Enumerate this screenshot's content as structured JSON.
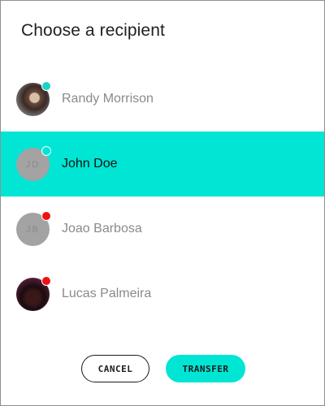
{
  "dialog": {
    "title": "Choose a recipient"
  },
  "recipients": [
    {
      "name": "Randy Morrison",
      "initials": "",
      "status_color": "#19d3c5",
      "selected": false
    },
    {
      "name": "John Doe",
      "initials": "JD",
      "status_color": "#00e5d4",
      "selected": true
    },
    {
      "name": "Joao Barbosa",
      "initials": "JB",
      "status_color": "#ee1111",
      "selected": false
    },
    {
      "name": "Lucas Palmeira",
      "initials": "",
      "status_color": "#ee1111",
      "selected": false
    }
  ],
  "actions": {
    "cancel_label": "CANCEL",
    "transfer_label": "TRANSFER"
  },
  "colors": {
    "accent": "#00e5d4",
    "online": "#19d3c5",
    "offline": "#ee1111"
  }
}
